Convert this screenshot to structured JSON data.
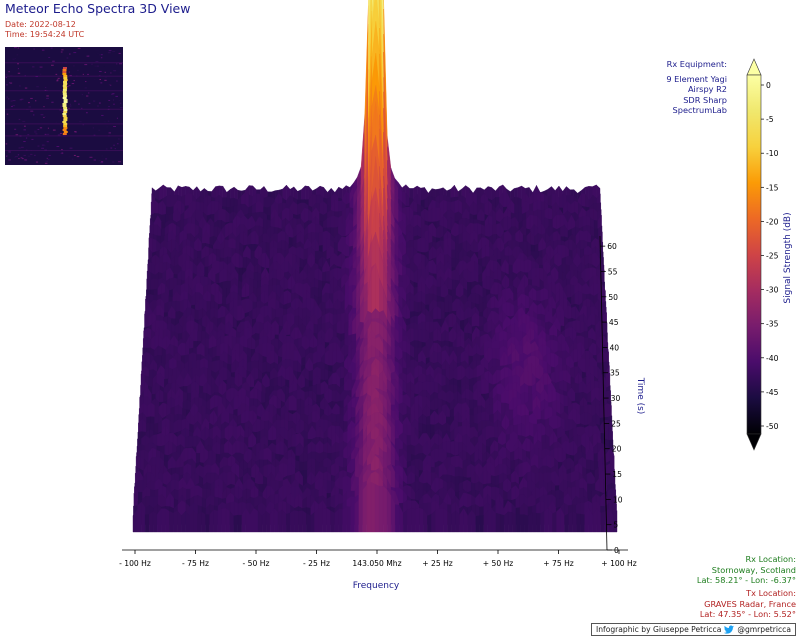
{
  "title": "Meteor Echo Spectra 3D View",
  "date_text": "Date: 2022-08-12",
  "time_text": "Time: 19:54:24 UTC",
  "rx_equipment": {
    "heading": "Rx Equipment:",
    "items": [
      "9 Element Yagi",
      "Airspy R2",
      "SDR Sharp",
      "SpectrumLab"
    ]
  },
  "rx_location": {
    "heading": "Rx Location:",
    "place": "Stornoway, Scotland",
    "coords": "Lat: 58.21° - Lon: -6.37°"
  },
  "tx_location": {
    "heading": "Tx Location:",
    "place": "GRAVES Radar, France",
    "coords": "Lat: 47.35° - Lon: 5.52°"
  },
  "credit": {
    "text": "Infographic by Giuseppe Petricca",
    "handle": "@gmrpetricca"
  },
  "colors": {
    "title": "#1c1c8c",
    "meta": "#c0392b",
    "rx_location": "#1e7d1e",
    "tx_location": "#b22222"
  },
  "chart_data": {
    "type": "surface-3d",
    "colormap": "inferno",
    "peak_frequency_offset_hz": 0,
    "x": {
      "label": "Frequency",
      "ticks": [
        "- 100 Hz",
        "- 75 Hz",
        "- 50 Hz",
        "- 25 Hz",
        "143.050 Mhz",
        "+ 25 Hz",
        "+ 50 Hz",
        "+ 75 Hz",
        "+ 100 Hz"
      ],
      "range": [
        -100,
        100
      ]
    },
    "y": {
      "label": "Time (s)",
      "ticks": [
        0,
        5,
        10,
        15,
        20,
        25,
        30,
        35,
        40,
        45,
        50,
        55,
        60
      ],
      "range": [
        0,
        62
      ]
    },
    "z": {
      "label": "Signal Strength (dB)",
      "ticks": [
        0,
        -5,
        -10,
        -15,
        -20,
        -25,
        -30,
        -35,
        -40,
        -45,
        -50
      ],
      "range": [
        -50,
        0
      ]
    }
  }
}
